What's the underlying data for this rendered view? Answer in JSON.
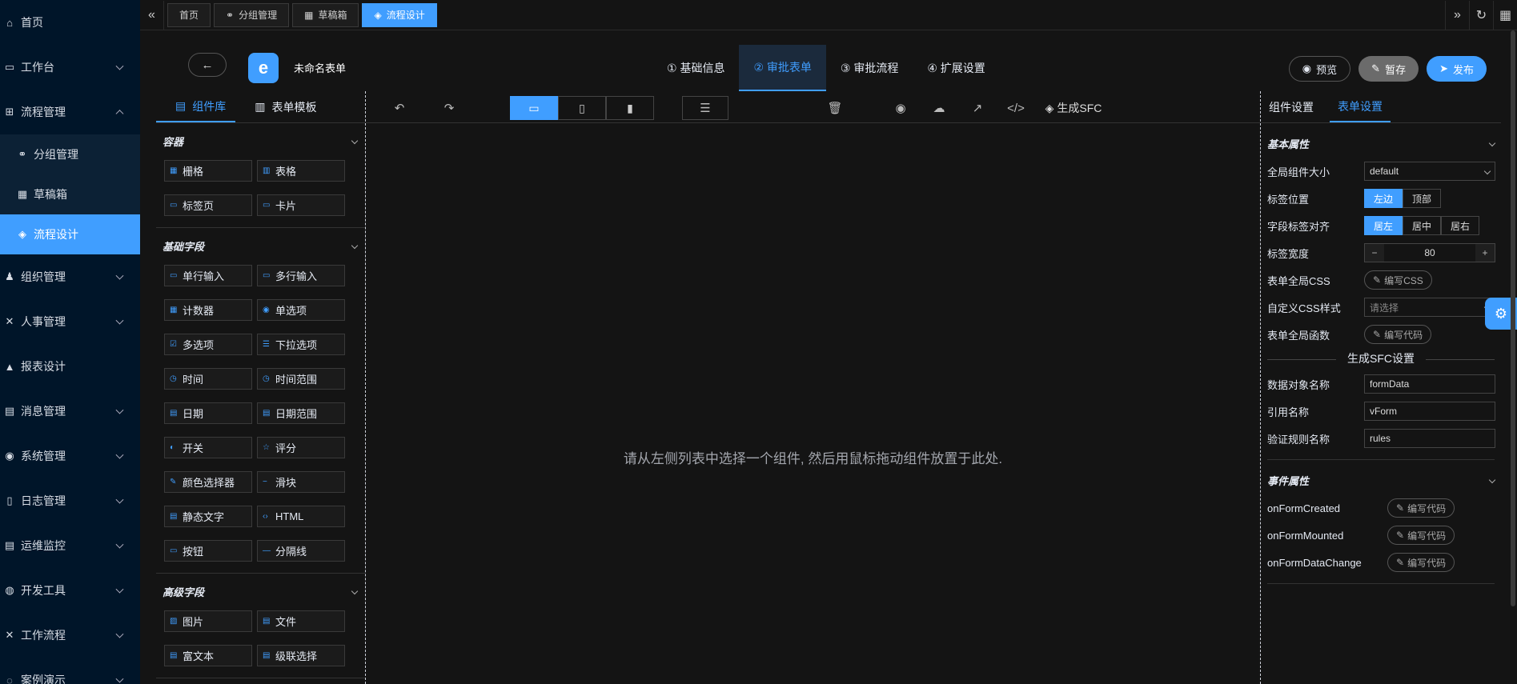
{
  "nav": [
    {
      "label": "首页",
      "icon": "home-icon",
      "glyph": "⌂"
    },
    {
      "label": "工作台",
      "icon": "monitor-icon",
      "glyph": "▭",
      "chev": "down"
    },
    {
      "label": "流程管理",
      "icon": "workflow-icon",
      "glyph": "⊞",
      "chev": "up"
    },
    {
      "label": "分组管理",
      "icon": "group-icon",
      "glyph": "⚭",
      "sub": true
    },
    {
      "label": "草稿箱",
      "icon": "grid-icon",
      "glyph": "▦",
      "sub": true
    },
    {
      "label": "流程设计",
      "icon": "design-icon",
      "glyph": "◈",
      "sub": true,
      "active": true
    },
    {
      "label": "组织管理",
      "icon": "user-icon",
      "glyph": "♟",
      "chev": "down"
    },
    {
      "label": "人事管理",
      "icon": "personnel-icon",
      "glyph": "✕",
      "chev": "down"
    },
    {
      "label": "报表设计",
      "icon": "report-icon",
      "glyph": "▲"
    },
    {
      "label": "消息管理",
      "icon": "message-icon",
      "glyph": "▤",
      "chev": "down"
    },
    {
      "label": "系统管理",
      "icon": "camera-icon",
      "glyph": "◉",
      "chev": "down"
    },
    {
      "label": "日志管理",
      "icon": "log-icon",
      "glyph": "▯",
      "chev": "down"
    },
    {
      "label": "运维监控",
      "icon": "monitor-ops-icon",
      "glyph": "▤",
      "chev": "down"
    },
    {
      "label": "开发工具",
      "icon": "dev-tools-icon",
      "glyph": "◍",
      "chev": "down"
    },
    {
      "label": "工作流程",
      "icon": "workflow2-icon",
      "glyph": "✕",
      "chev": "down"
    },
    {
      "label": "案例演示",
      "icon": "demo-icon",
      "glyph": "◌",
      "chev": "down"
    }
  ],
  "tabs": [
    {
      "label": "首页",
      "icon": ""
    },
    {
      "label": "分组管理",
      "icon": "⚭"
    },
    {
      "label": "草稿箱",
      "icon": "▦"
    },
    {
      "label": "流程设计",
      "icon": "◈",
      "active": true
    }
  ],
  "header": {
    "form_name": "未命名表单",
    "steps": [
      {
        "label": "① 基础信息"
      },
      {
        "label": "② 审批表单",
        "active": true
      },
      {
        "label": "③ 审批流程"
      },
      {
        "label": "④ 扩展设置"
      }
    ],
    "preview": "预览",
    "save": "暂存",
    "publish": "发布"
  },
  "left": {
    "tab_components": "组件库",
    "tab_templates": "表单模板",
    "sections": [
      {
        "title": "容器",
        "items": [
          "栅格",
          "表格",
          "标签页",
          "卡片"
        ]
      },
      {
        "title": "基础字段",
        "items": [
          "单行输入",
          "多行输入",
          "计数器",
          "单选项",
          "多选项",
          "下拉选项",
          "时间",
          "时间范围",
          "日期",
          "日期范围",
          "开关",
          "评分",
          "颜色选择器",
          "滑块",
          "静态文字",
          "HTML",
          "按钮",
          "分隔线"
        ]
      },
      {
        "title": "高级字段",
        "items": [
          "图片",
          "文件",
          "富文本",
          "级联选择"
        ]
      }
    ]
  },
  "center": {
    "generate_sfc": "生成SFC",
    "hint": "请从左侧列表中选择一个组件, 然后用鼠标拖动组件放置于此处."
  },
  "right": {
    "tab_component": "组件设置",
    "tab_form": "表单设置",
    "basic_title": "基本属性",
    "size_label": "全局组件大小",
    "size_value": "default",
    "label_pos_label": "标签位置",
    "label_pos": [
      "左边",
      "顶部"
    ],
    "align_label": "字段标签对齐",
    "align": [
      "居左",
      "居中",
      "居右"
    ],
    "width_label": "标签宽度",
    "width_value": "80",
    "css_label": "表单全局CSS",
    "css_btn": "编写CSS",
    "custom_css_label": "自定义CSS样式",
    "custom_css_placeholder": "请选择",
    "func_label": "表单全局函数",
    "func_btn": "编写代码",
    "sfc_title": "生成SFC设置",
    "data_obj_label": "数据对象名称",
    "data_obj_value": "formData",
    "ref_label": "引用名称",
    "ref_value": "vForm",
    "rules_label": "验证规则名称",
    "rules_value": "rules",
    "event_title": "事件属性",
    "events": [
      "onFormCreated",
      "onFormMounted",
      "onFormDataChange"
    ],
    "event_btn": "编写代码"
  },
  "colors": {
    "accent": "#409eff",
    "sidebar": "#001529",
    "background": "#141414"
  }
}
